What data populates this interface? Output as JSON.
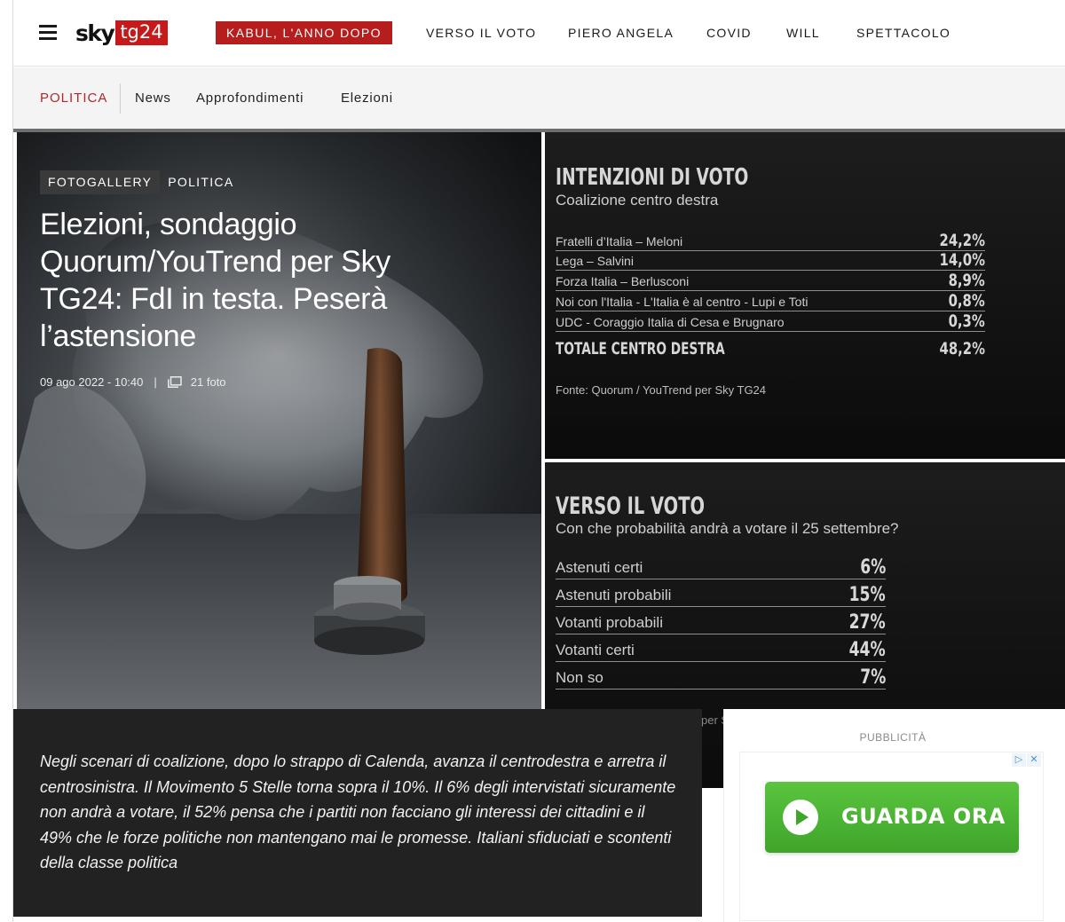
{
  "header": {
    "logo_sky": "sky",
    "logo_tg": "tg24",
    "badge": "KABUL, L'ANNO DOPO",
    "nav": [
      "VERSO IL VOTO",
      "PIERO ANGELA",
      "COVID",
      "WILL",
      "SPETTACOLO"
    ],
    "brand_color": "#c8191a"
  },
  "subnav": {
    "section": "POLITICA",
    "links": [
      "News",
      "Approfondimenti",
      "Elezioni"
    ]
  },
  "hero": {
    "tag_gallery": "FOTOGALLERY",
    "tag_section": "POLITICA",
    "title": "Elezioni, sondaggio Quorum/YouTrend per Sky TG24: FdI in testa. Peserà l’astensione",
    "date": "09 ago 2022 - 10:40",
    "separator": "|",
    "photos": "21 foto"
  },
  "poll1": {
    "title": "INTENZIONI DI VOTO",
    "subtitle": "Coalizione centro destra",
    "rows": [
      {
        "label": "Fratelli d’Italia – Meloni",
        "value": "24,2%"
      },
      {
        "label": "Lega – Salvini",
        "value": "14,0%"
      },
      {
        "label": "Forza Italia – Berlusconi",
        "value": "8,9%"
      },
      {
        "label": "Noi con l'Italia - L'Italia è al centro - Lupi e Toti",
        "value": "0,8%"
      },
      {
        "label": "UDC - Coraggio Italia di Cesa e Brugnaro",
        "value": "0,3%"
      }
    ],
    "total_label": "TOTALE CENTRO DESTRA",
    "total_value": "48,2%",
    "source": "Fonte: Quorum / YouTrend per Sky TG24"
  },
  "poll2": {
    "title": "VERSO IL VOTO",
    "subtitle": "Con che probabilità andrà a votare il 25 settembre?",
    "rows": [
      {
        "label": "Astenuti certi",
        "value": "6%"
      },
      {
        "label": "Astenuti probabili",
        "value": "15%"
      },
      {
        "label": "Votanti probabili",
        "value": "27%"
      },
      {
        "label": "Votanti certi",
        "value": "44%"
      },
      {
        "label": "Non so",
        "value": "7%"
      }
    ],
    "source_fragment": "per S"
  },
  "description": "Negli scenari di coalizione, dopo lo strappo di Calenda, avanza il centrodestra e arretra il centrosinistra. Il Movimento 5 Stelle torna sopra il 10%. Il 6% degli intervistati sicuramente non andrà a votare, il 52% pensa che i partiti non facciano gli interessi dei cittadini e il 49% che le forze politiche non mantengano mai le promesse. Italiani sfiduciati e scontenti della classe politica",
  "ad": {
    "label": "PUBBLICITÀ",
    "cta": "GUARDA ORA",
    "choices_icon": "▷",
    "close_icon": "✕",
    "cta_color": "#4fb737"
  }
}
